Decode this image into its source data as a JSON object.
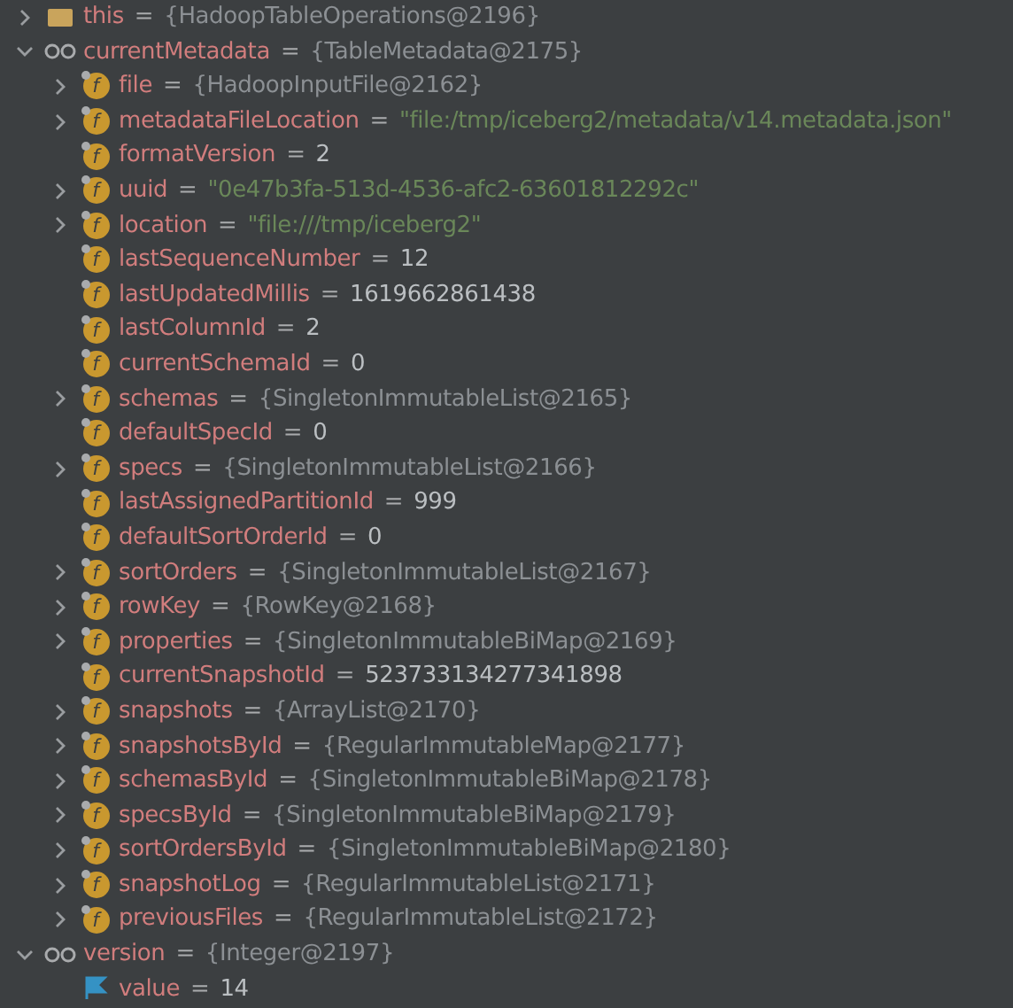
{
  "separator": "=",
  "nodes": [
    {
      "kind": "object",
      "name": "this",
      "value": {
        "kind": "object",
        "text": "{HadoopTableOperations@2196}"
      },
      "expanded": false
    },
    {
      "kind": "watch",
      "name": "currentMetadata",
      "value": {
        "kind": "object",
        "text": "{TableMetadata@2175}"
      },
      "expanded": true,
      "children": [
        {
          "kind": "field",
          "icon_letter": "f",
          "name": "file",
          "value": {
            "kind": "object",
            "text": "{HadoopInputFile@2162}"
          },
          "expanded": false
        },
        {
          "kind": "field",
          "icon_letter": "f",
          "name": "metadataFileLocation",
          "value": {
            "kind": "string",
            "text": "\"file:/tmp/iceberg2/metadata/v14.metadata.json\""
          },
          "expanded": false
        },
        {
          "kind": "field",
          "icon_letter": "f",
          "name": "formatVersion",
          "value": {
            "kind": "number",
            "text": "2"
          }
        },
        {
          "kind": "field",
          "icon_letter": "f",
          "name": "uuid",
          "value": {
            "kind": "string",
            "text": "\"0e47b3fa-513d-4536-afc2-63601812292c\""
          },
          "expanded": false
        },
        {
          "kind": "field",
          "icon_letter": "f",
          "name": "location",
          "value": {
            "kind": "string",
            "text": "\"file:///tmp/iceberg2\""
          },
          "expanded": false
        },
        {
          "kind": "field",
          "icon_letter": "f",
          "name": "lastSequenceNumber",
          "value": {
            "kind": "number",
            "text": "12"
          }
        },
        {
          "kind": "field",
          "icon_letter": "f",
          "name": "lastUpdatedMillis",
          "value": {
            "kind": "number",
            "text": "1619662861438"
          }
        },
        {
          "kind": "field",
          "icon_letter": "f",
          "name": "lastColumnId",
          "value": {
            "kind": "number",
            "text": "2"
          }
        },
        {
          "kind": "field",
          "icon_letter": "f",
          "name": "currentSchemaId",
          "value": {
            "kind": "number",
            "text": "0"
          }
        },
        {
          "kind": "field",
          "icon_letter": "f",
          "name": "schemas",
          "value": {
            "kind": "object",
            "text": "{SingletonImmutableList@2165}"
          },
          "expanded": false
        },
        {
          "kind": "field",
          "icon_letter": "f",
          "name": "defaultSpecId",
          "value": {
            "kind": "number",
            "text": "0"
          }
        },
        {
          "kind": "field",
          "icon_letter": "f",
          "name": "specs",
          "value": {
            "kind": "object",
            "text": "{SingletonImmutableList@2166}"
          },
          "expanded": false
        },
        {
          "kind": "field",
          "icon_letter": "f",
          "name": "lastAssignedPartitionId",
          "value": {
            "kind": "number",
            "text": "999"
          }
        },
        {
          "kind": "field",
          "icon_letter": "f",
          "name": "defaultSortOrderId",
          "value": {
            "kind": "number",
            "text": "0"
          }
        },
        {
          "kind": "field",
          "icon_letter": "f",
          "name": "sortOrders",
          "value": {
            "kind": "object",
            "text": "{SingletonImmutableList@2167}"
          },
          "expanded": false
        },
        {
          "kind": "field",
          "icon_letter": "f",
          "name": "rowKey",
          "value": {
            "kind": "object",
            "text": "{RowKey@2168}"
          },
          "expanded": false
        },
        {
          "kind": "field",
          "icon_letter": "f",
          "name": "properties",
          "value": {
            "kind": "object",
            "text": "{SingletonImmutableBiMap@2169}"
          },
          "expanded": false
        },
        {
          "kind": "field",
          "icon_letter": "f",
          "name": "currentSnapshotId",
          "value": {
            "kind": "number",
            "text": "523733134277341898"
          }
        },
        {
          "kind": "field",
          "icon_letter": "f",
          "name": "snapshots",
          "value": {
            "kind": "object",
            "text": "{ArrayList@2170}"
          },
          "expanded": false
        },
        {
          "kind": "field",
          "icon_letter": "f",
          "name": "snapshotsById",
          "value": {
            "kind": "object",
            "text": "{RegularImmutableMap@2177}"
          },
          "expanded": false
        },
        {
          "kind": "field",
          "icon_letter": "f",
          "name": "schemasById",
          "value": {
            "kind": "object",
            "text": "{SingletonImmutableBiMap@2178}"
          },
          "expanded": false
        },
        {
          "kind": "field",
          "icon_letter": "f",
          "name": "specsById",
          "value": {
            "kind": "object",
            "text": "{SingletonImmutableBiMap@2179}"
          },
          "expanded": false
        },
        {
          "kind": "field",
          "icon_letter": "f",
          "name": "sortOrdersById",
          "value": {
            "kind": "object",
            "text": "{SingletonImmutableBiMap@2180}"
          },
          "expanded": false
        },
        {
          "kind": "field",
          "icon_letter": "f",
          "name": "snapshotLog",
          "value": {
            "kind": "object",
            "text": "{RegularImmutableList@2171}"
          },
          "expanded": false
        },
        {
          "kind": "field",
          "icon_letter": "f",
          "name": "previousFiles",
          "value": {
            "kind": "object",
            "text": "{RegularImmutableList@2172}"
          },
          "expanded": false
        }
      ]
    },
    {
      "kind": "watch",
      "name": "version",
      "value": {
        "kind": "object",
        "text": "{Integer@2197}"
      },
      "expanded": true,
      "children": [
        {
          "kind": "primitive",
          "name": "value",
          "value": {
            "kind": "number",
            "text": "14"
          }
        }
      ]
    }
  ]
}
